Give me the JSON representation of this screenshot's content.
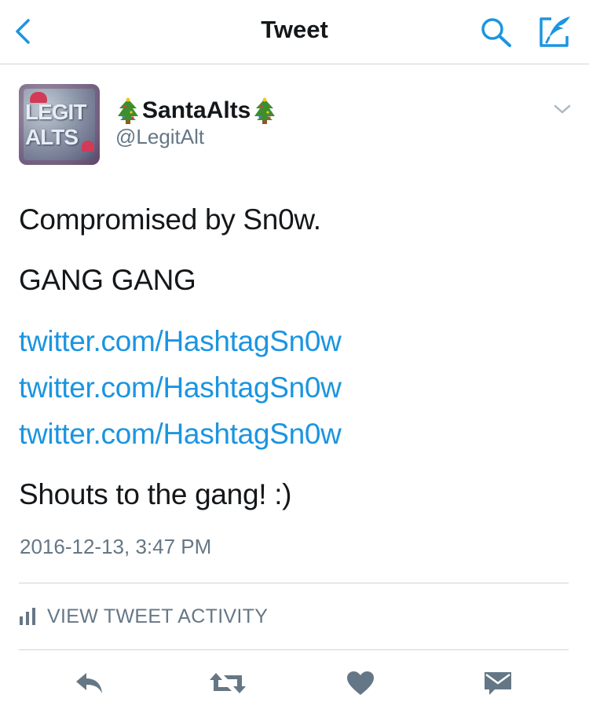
{
  "navbar": {
    "title": "Tweet",
    "back_icon": "chevron-left-icon",
    "search_icon": "search-icon",
    "compose_icon": "compose-tweet-icon"
  },
  "author": {
    "display_name": "SantaAlts",
    "name_emoji": "christmas-tree-icon",
    "handle": "@LegitAlt"
  },
  "tweet": {
    "lines": [
      "Compromised by Sn0w.",
      "GANG GANG"
    ],
    "links": [
      "twitter.com/HashtagSn0w",
      "twitter.com/HashtagSn0w",
      "twitter.com/HashtagSn0w"
    ],
    "closing": "Shouts to the gang! :)",
    "timestamp": "2016-12-13, 3:47 PM"
  },
  "activity": {
    "label": "VIEW TWEET ACTIVITY",
    "icon": "bar-chart-icon"
  },
  "actions": [
    {
      "name": "reply",
      "icon": "reply-icon"
    },
    {
      "name": "retweet",
      "icon": "retweet-icon"
    },
    {
      "name": "like",
      "icon": "heart-icon"
    },
    {
      "name": "direct-message",
      "icon": "envelope-icon"
    }
  ],
  "colors": {
    "accent": "#1b95e0",
    "text": "#14171a",
    "secondary": "#657786",
    "action_gray": "#657786",
    "divider": "#cfd4d9"
  }
}
